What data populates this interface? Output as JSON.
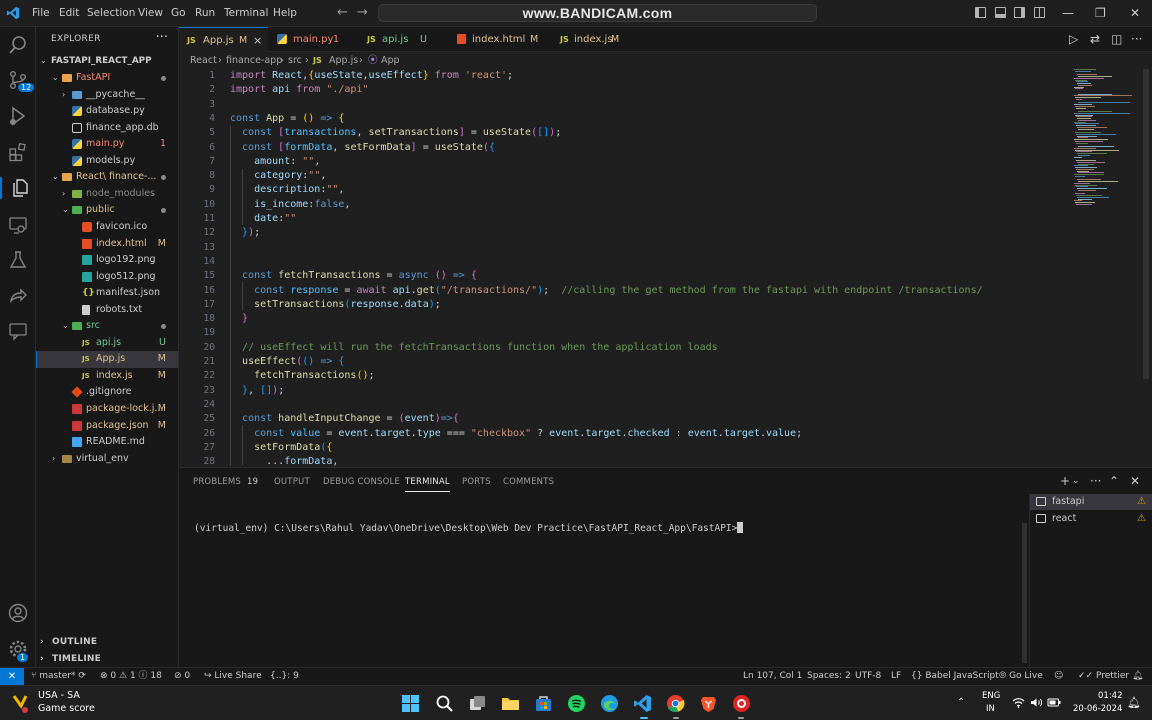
{
  "menu": [
    "File",
    "Edit",
    "Selection",
    "View",
    "Go",
    "Run",
    "Terminal",
    "Help"
  ],
  "command_center": "www.BANDICAM.com",
  "explorer": {
    "title": "EXPLORER",
    "root": "FASTAPI_REACT_APP",
    "items": [
      {
        "label": "FastAPI",
        "status": "dot",
        "color": "#f48771"
      },
      {
        "label": "__pycache__",
        "status": "",
        "color": "#cccccc"
      },
      {
        "label": "database.py",
        "status": "",
        "color": "#cccccc"
      },
      {
        "label": "finance_app.db",
        "status": "",
        "color": "#cccccc"
      },
      {
        "label": "main.py",
        "status": "1",
        "color": "#f48771"
      },
      {
        "label": "models.py",
        "status": "",
        "color": "#cccccc"
      },
      {
        "label": "React\\ finance-...",
        "status": "dot",
        "color": "#e2c08d"
      },
      {
        "label": "node_modules",
        "status": "",
        "color": "#8b8b8b"
      },
      {
        "label": "public",
        "status": "dot",
        "color": "#e2c08d"
      },
      {
        "label": "favicon.ico",
        "status": "",
        "color": "#cccccc"
      },
      {
        "label": "index.html",
        "status": "M",
        "color": "#e2c08d"
      },
      {
        "label": "logo192.png",
        "status": "",
        "color": "#cccccc"
      },
      {
        "label": "logo512.png",
        "status": "",
        "color": "#cccccc"
      },
      {
        "label": "manifest.json",
        "status": "",
        "color": "#cccccc"
      },
      {
        "label": "robots.txt",
        "status": "",
        "color": "#cccccc"
      },
      {
        "label": "src",
        "status": "dot",
        "color": "#73c991"
      },
      {
        "label": "api.js",
        "status": "U",
        "color": "#73c991"
      },
      {
        "label": "App.js",
        "status": "M",
        "color": "#e2c08d"
      },
      {
        "label": "index.js",
        "status": "M",
        "color": "#e2c08d"
      },
      {
        "label": ".gitignore",
        "status": "",
        "color": "#cccccc"
      },
      {
        "label": "package-lock.j...",
        "status": "M",
        "color": "#e2c08d"
      },
      {
        "label": "package.json",
        "status": "M",
        "color": "#e2c08d"
      },
      {
        "label": "README.md",
        "status": "",
        "color": "#cccccc"
      },
      {
        "label": "virtual_env",
        "status": "",
        "color": "#cccccc"
      }
    ],
    "outline": "OUTLINE",
    "timeline": "TIMELINE"
  },
  "tabs": [
    {
      "icon": "JS",
      "label": "App.js",
      "mark": "M",
      "close": "×"
    },
    {
      "icon": "py",
      "label": "main.py",
      "mark": "1",
      "close": ""
    },
    {
      "icon": "JS",
      "label": "api.js",
      "mark": "U",
      "close": ""
    },
    {
      "icon": "html",
      "label": "index.html",
      "mark": "M",
      "close": ""
    },
    {
      "icon": "JS",
      "label": "index.js",
      "mark": "M",
      "close": ""
    }
  ],
  "breadcrumb": [
    "React",
    "finance-app",
    "src",
    "JS",
    "App.js",
    "App"
  ],
  "code": [
    {
      "n": "1",
      "t": [
        [
          "t-ctl",
          "import "
        ],
        [
          "t-var",
          "React"
        ],
        [
          "t-pun",
          ","
        ],
        [
          "t-br1",
          "{"
        ],
        [
          "t-var",
          "useState"
        ],
        [
          "t-pun",
          ","
        ],
        [
          "t-var",
          "useEffect"
        ],
        [
          "t-br1",
          "}"
        ],
        [
          "t-ctl",
          " from "
        ],
        [
          "t-str",
          "'react'"
        ],
        [
          "t-pun",
          ";"
        ]
      ]
    },
    {
      "n": "2",
      "t": [
        [
          "t-ctl",
          "import "
        ],
        [
          "t-var",
          "api"
        ],
        [
          "t-ctl",
          " from "
        ],
        [
          "t-str",
          "\"./api\""
        ]
      ]
    },
    {
      "n": "3",
      "t": []
    },
    {
      "n": "4",
      "t": [
        [
          "t-kw",
          "const "
        ],
        [
          "t-fn",
          "App"
        ],
        [
          "t-pun",
          " = "
        ],
        [
          "t-br1",
          "()"
        ],
        [
          "t-kw",
          " => "
        ],
        [
          "t-br1",
          "{"
        ]
      ]
    },
    {
      "n": "5",
      "t": [
        [
          "t-def",
          "  "
        ],
        [
          "t-kw",
          "const "
        ],
        [
          "t-br2",
          "["
        ],
        [
          "t-cst",
          "transactions"
        ],
        [
          "t-pun",
          ", "
        ],
        [
          "t-fn",
          "setTransactions"
        ],
        [
          "t-br2",
          "]"
        ],
        [
          "t-pun",
          " = "
        ],
        [
          "t-fn",
          "useState"
        ],
        [
          "t-br2",
          "("
        ],
        [
          "t-br3",
          "[]"
        ],
        [
          "t-br2",
          ")"
        ],
        [
          "t-pun",
          ";"
        ]
      ]
    },
    {
      "n": "6",
      "t": [
        [
          "t-def",
          "  "
        ],
        [
          "t-kw",
          "const "
        ],
        [
          "t-br2",
          "["
        ],
        [
          "t-cst",
          "formData"
        ],
        [
          "t-pun",
          ", "
        ],
        [
          "t-fn",
          "setFormData"
        ],
        [
          "t-br2",
          "]"
        ],
        [
          "t-pun",
          " = "
        ],
        [
          "t-fn",
          "useState"
        ],
        [
          "t-br2",
          "("
        ],
        [
          "t-br3",
          "{"
        ]
      ]
    },
    {
      "n": "7",
      "t": [
        [
          "t-def",
          "    "
        ],
        [
          "t-var",
          "amount"
        ],
        [
          "t-pun",
          ": "
        ],
        [
          "t-str",
          "\"\""
        ],
        [
          "t-pun",
          ","
        ]
      ]
    },
    {
      "n": "8",
      "t": [
        [
          "t-def",
          "    "
        ],
        [
          "t-var",
          "category"
        ],
        [
          "t-pun",
          ":"
        ],
        [
          "t-str",
          "\"\""
        ],
        [
          "t-pun",
          ","
        ]
      ]
    },
    {
      "n": "9",
      "t": [
        [
          "t-def",
          "    "
        ],
        [
          "t-var",
          "description"
        ],
        [
          "t-pun",
          ":"
        ],
        [
          "t-str",
          "\"\""
        ],
        [
          "t-pun",
          ","
        ]
      ]
    },
    {
      "n": "10",
      "t": [
        [
          "t-def",
          "    "
        ],
        [
          "t-var",
          "is_income"
        ],
        [
          "t-pun",
          ":"
        ],
        [
          "t-kw",
          "false"
        ],
        [
          "t-pun",
          ","
        ]
      ]
    },
    {
      "n": "11",
      "t": [
        [
          "t-def",
          "    "
        ],
        [
          "t-var",
          "date"
        ],
        [
          "t-pun",
          ":"
        ],
        [
          "t-str",
          "\"\""
        ]
      ]
    },
    {
      "n": "12",
      "t": [
        [
          "t-def",
          "  "
        ],
        [
          "t-br3",
          "}"
        ],
        [
          "t-br2",
          ")"
        ],
        [
          "t-pun",
          ";"
        ]
      ]
    },
    {
      "n": "13",
      "t": []
    },
    {
      "n": "14",
      "t": []
    },
    {
      "n": "15",
      "t": [
        [
          "t-def",
          "  "
        ],
        [
          "t-kw",
          "const "
        ],
        [
          "t-fn",
          "fetchTransactions"
        ],
        [
          "t-pun",
          " = "
        ],
        [
          "t-kw",
          "async "
        ],
        [
          "t-br2",
          "()"
        ],
        [
          "t-kw",
          " => "
        ],
        [
          "t-br2",
          "{"
        ]
      ]
    },
    {
      "n": "16",
      "t": [
        [
          "t-def",
          "    "
        ],
        [
          "t-kw",
          "const "
        ],
        [
          "t-cst",
          "response"
        ],
        [
          "t-pun",
          " = "
        ],
        [
          "t-ctl",
          "await "
        ],
        [
          "t-var",
          "api"
        ],
        [
          "t-pun",
          "."
        ],
        [
          "t-fn",
          "get"
        ],
        [
          "t-br3",
          "("
        ],
        [
          "t-str",
          "\"/transactions/\""
        ],
        [
          "t-br3",
          ")"
        ],
        [
          "t-pun",
          ";  "
        ],
        [
          "t-com",
          "//calling the get method from the fastapi with endpoint /transactions/"
        ]
      ]
    },
    {
      "n": "17",
      "t": [
        [
          "t-def",
          "    "
        ],
        [
          "t-fn",
          "setTransactions"
        ],
        [
          "t-br3",
          "("
        ],
        [
          "t-var",
          "response"
        ],
        [
          "t-pun",
          "."
        ],
        [
          "t-var",
          "data"
        ],
        [
          "t-br3",
          ")"
        ],
        [
          "t-pun",
          ";"
        ]
      ]
    },
    {
      "n": "18",
      "t": [
        [
          "t-def",
          "  "
        ],
        [
          "t-br2",
          "}"
        ]
      ]
    },
    {
      "n": "19",
      "t": []
    },
    {
      "n": "20",
      "t": [
        [
          "t-def",
          "  "
        ],
        [
          "t-com",
          "// useEffect will run the fetchTransactions function when the application loads"
        ]
      ]
    },
    {
      "n": "21",
      "t": [
        [
          "t-def",
          "  "
        ],
        [
          "t-fn",
          "useEffect"
        ],
        [
          "t-br2",
          "("
        ],
        [
          "t-br3",
          "()"
        ],
        [
          "t-kw",
          " => "
        ],
        [
          "t-br3",
          "{"
        ]
      ]
    },
    {
      "n": "22",
      "t": [
        [
          "t-def",
          "    "
        ],
        [
          "t-fn",
          "fetchTransactions"
        ],
        [
          "t-br1",
          "()"
        ],
        [
          "t-pun",
          ";"
        ]
      ]
    },
    {
      "n": "23",
      "t": [
        [
          "t-def",
          "  "
        ],
        [
          "t-br3",
          "}"
        ],
        [
          "t-pun",
          ", "
        ],
        [
          "t-br3",
          "[]"
        ],
        [
          "t-br2",
          ")"
        ],
        [
          "t-pun",
          ";"
        ]
      ]
    },
    {
      "n": "24",
      "t": []
    },
    {
      "n": "25",
      "t": [
        [
          "t-def",
          "  "
        ],
        [
          "t-kw",
          "const "
        ],
        [
          "t-fn",
          "handleInputChange"
        ],
        [
          "t-pun",
          " = "
        ],
        [
          "t-br2",
          "("
        ],
        [
          "t-var",
          "event"
        ],
        [
          "t-br2",
          ")"
        ],
        [
          "t-kw",
          "=>"
        ],
        [
          "t-br2",
          "{"
        ]
      ]
    },
    {
      "n": "26",
      "t": [
        [
          "t-def",
          "    "
        ],
        [
          "t-kw",
          "const "
        ],
        [
          "t-cst",
          "value"
        ],
        [
          "t-pun",
          " = "
        ],
        [
          "t-var",
          "event"
        ],
        [
          "t-pun",
          "."
        ],
        [
          "t-var",
          "target"
        ],
        [
          "t-pun",
          "."
        ],
        [
          "t-var",
          "type"
        ],
        [
          "t-pun",
          " === "
        ],
        [
          "t-str",
          "\"checkbox\""
        ],
        [
          "t-pun",
          " ? "
        ],
        [
          "t-var",
          "event"
        ],
        [
          "t-pun",
          "."
        ],
        [
          "t-var",
          "target"
        ],
        [
          "t-pun",
          "."
        ],
        [
          "t-var",
          "checked"
        ],
        [
          "t-pun",
          " : "
        ],
        [
          "t-var",
          "event"
        ],
        [
          "t-pun",
          "."
        ],
        [
          "t-var",
          "target"
        ],
        [
          "t-pun",
          "."
        ],
        [
          "t-var",
          "value"
        ],
        [
          "t-pun",
          ";"
        ]
      ]
    },
    {
      "n": "27",
      "t": [
        [
          "t-def",
          "    "
        ],
        [
          "t-fn",
          "setFormData"
        ],
        [
          "t-br3",
          "("
        ],
        [
          "t-br1",
          "{"
        ]
      ]
    },
    {
      "n": "28",
      "t": [
        [
          "t-def",
          "      "
        ],
        [
          "t-pun",
          "..."
        ],
        [
          "t-var",
          "formData"
        ],
        [
          "t-pun",
          ","
        ]
      ]
    }
  ],
  "panel": {
    "tabs": [
      "PROBLEMS",
      "OUTPUT",
      "DEBUG CONSOLE",
      "TERMINAL",
      "PORTS",
      "COMMENTS"
    ],
    "problems_count": "19",
    "active_tab": "TERMINAL",
    "terminal_line": "(virtual_env) C:\\Users\\Rahul Yadav\\OneDrive\\Desktop\\Web Dev Practice\\FastAPI_React_App\\FastAPI>",
    "terminals": [
      {
        "label": "fastapi",
        "warn": "⚠"
      },
      {
        "label": "react",
        "warn": "⚠"
      }
    ]
  },
  "status": {
    "branch": "master*",
    "errors": "0",
    "warnings": "1",
    "infos": "18",
    "ports": "0",
    "live_share": "Live Share",
    "braces": "{..}: 9",
    "position": "Ln 107, Col 1",
    "spaces": "Spaces: 2",
    "encoding": "UTF-8",
    "eol": "LF",
    "language": "Babel JavaScript",
    "golive": "Go Live",
    "prettier": "Prettier"
  },
  "taskbar": {
    "weather_title": "USA - SA",
    "weather_sub": "Game score",
    "lang": "ENG",
    "region": "IN",
    "time": "01:42",
    "date": "20-06-2024"
  },
  "colors": {
    "accent": "#0078d4",
    "modified": "#e2c08d",
    "untracked": "#73c991",
    "error": "#f48771",
    "js_icon": "#cbcb41",
    "html_icon": "#e44d26",
    "py_icon": "#3572a5"
  }
}
